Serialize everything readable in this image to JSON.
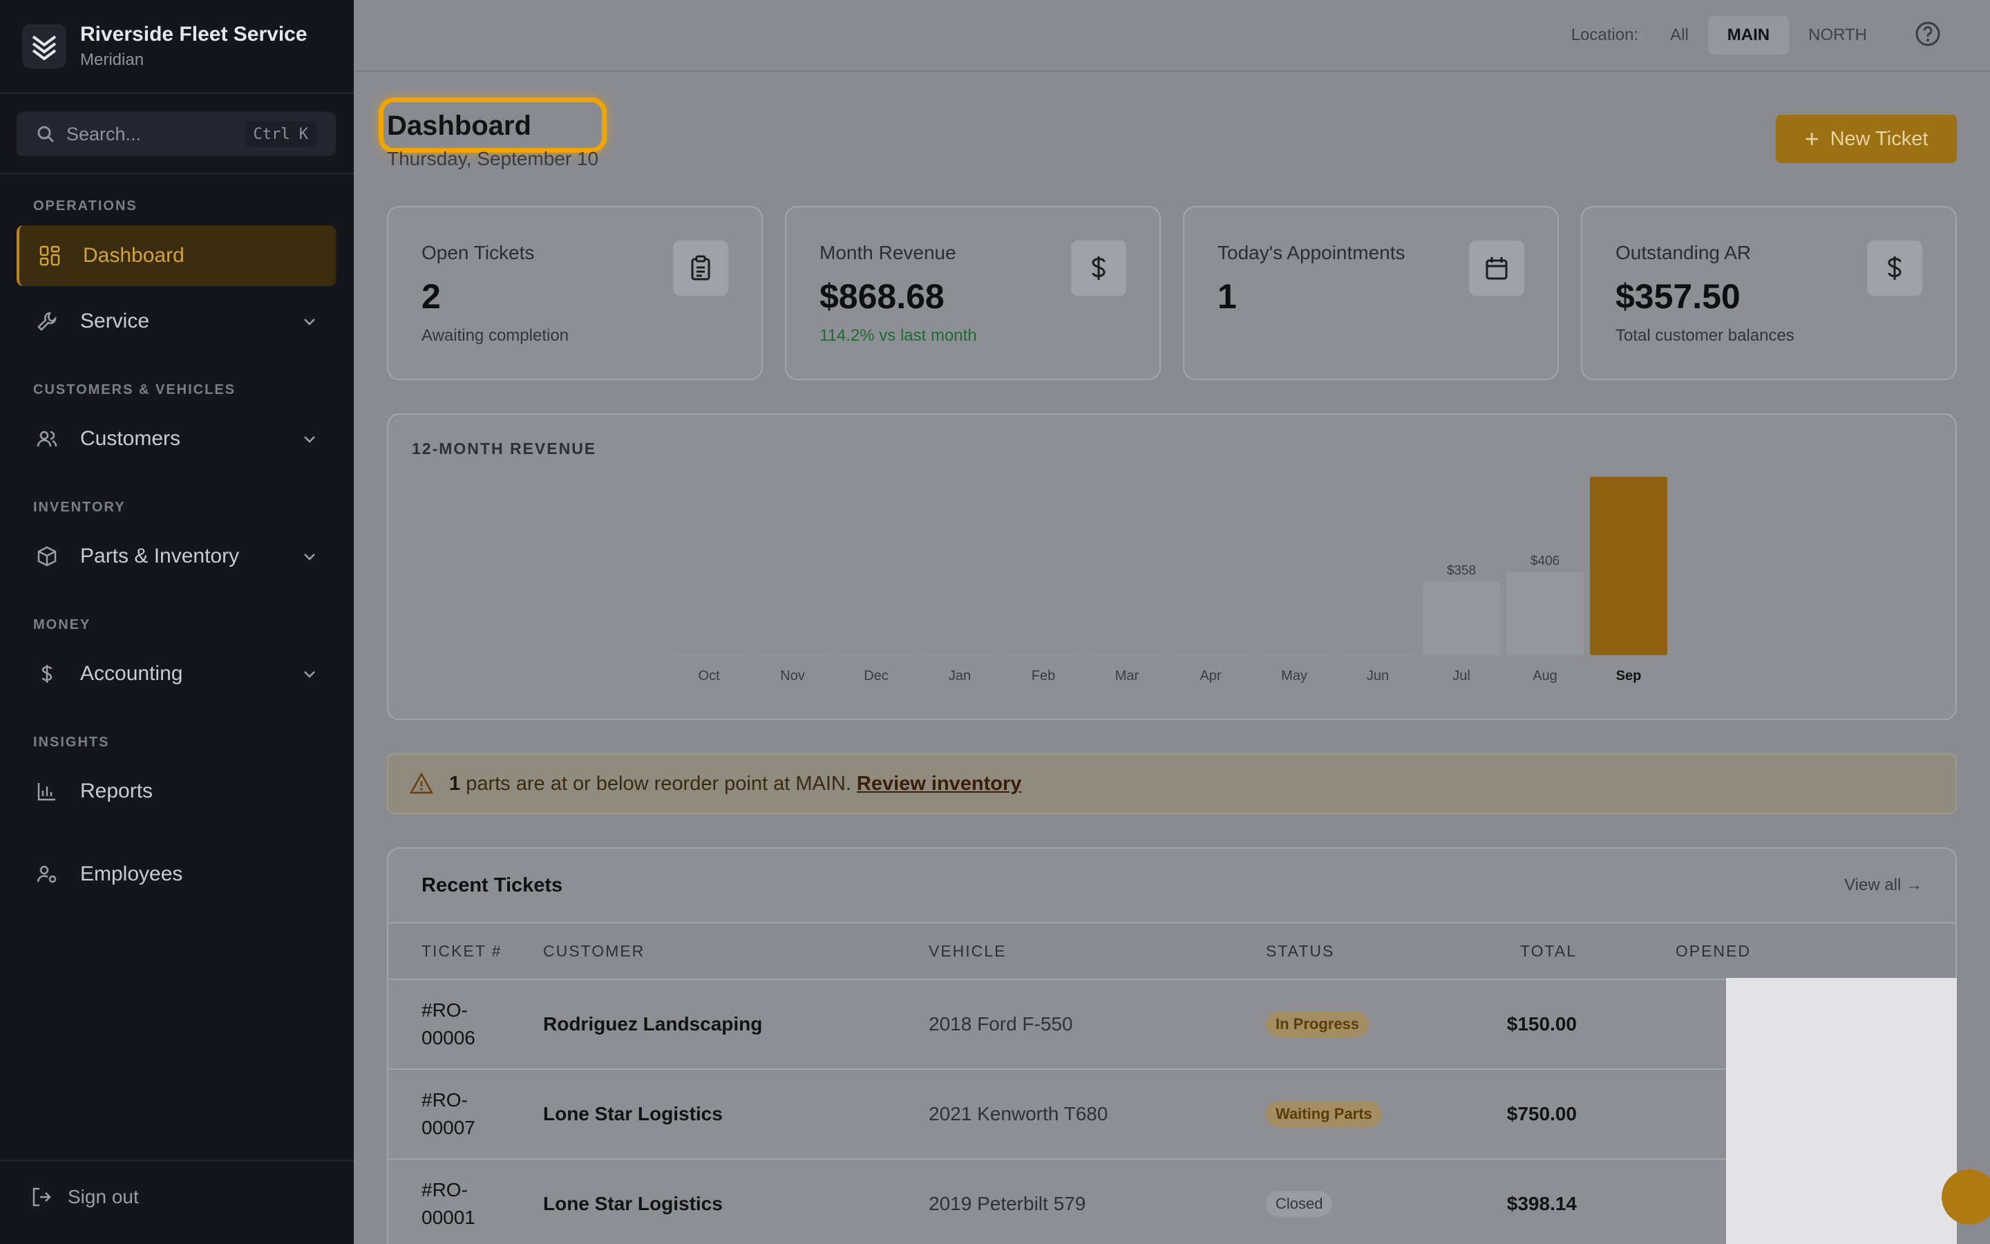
{
  "app": {
    "name": "Riverside Fleet Service",
    "subtitle": "Meridian"
  },
  "search": {
    "placeholder": "Search...",
    "shortcut": "Ctrl K"
  },
  "sidebar": {
    "sections": {
      "operations": "OPERATIONS",
      "customers_vehicles": "CUSTOMERS & VEHICLES",
      "inventory": "INVENTORY",
      "money": "MONEY",
      "insights": "INSIGHTS"
    },
    "items": {
      "dashboard": "Dashboard",
      "service": "Service",
      "customers": "Customers",
      "parts": "Parts & Inventory",
      "accounting": "Accounting",
      "reports": "Reports",
      "employees": "Employees"
    },
    "signout": "Sign out"
  },
  "topbar": {
    "location_label": "Location:",
    "locations": [
      "All",
      "MAIN",
      "NORTH"
    ],
    "selected_location": "MAIN"
  },
  "page": {
    "title": "Dashboard",
    "date": "Thursday, September 10",
    "new_ticket": "New Ticket"
  },
  "cards": [
    {
      "title": "Open Tickets",
      "value": "2",
      "sub": "Awaiting completion",
      "icon": "clipboard-icon"
    },
    {
      "title": "Month Revenue",
      "value": "$868.68",
      "sub": "114.2% vs last month",
      "icon": "dollar-icon"
    },
    {
      "title": "Today's Appointments",
      "value": "1",
      "sub": "",
      "icon": "calendar-icon"
    },
    {
      "title": "Outstanding AR",
      "value": "$357.50",
      "sub": "Total customer balances",
      "icon": "dollar-icon"
    }
  ],
  "chart_data": {
    "type": "bar",
    "title": "12-MONTH REVENUE",
    "categories": [
      "Oct",
      "Nov",
      "Dec",
      "Jan",
      "Feb",
      "Mar",
      "Apr",
      "May",
      "Jun",
      "Jul",
      "Aug",
      "Sep"
    ],
    "values": [
      0,
      0,
      0,
      0,
      0,
      0,
      0,
      0,
      0,
      358,
      406,
      868.68
    ],
    "data_labels": [
      "",
      "",
      "",
      "",
      "",
      "",
      "",
      "",
      "",
      "$358",
      "$406",
      ""
    ],
    "highlight": "Sep",
    "colors": {
      "bar": "#96979c",
      "highlight": "#8e6112"
    }
  },
  "alert": {
    "count": "1",
    "text": "parts are at or below reorder point at MAIN.",
    "link": "Review inventory"
  },
  "tickets": {
    "title": "Recent Tickets",
    "view_all": "View all →",
    "headers": {
      "num": "TICKET #",
      "customer": "CUSTOMER",
      "vehicle": "VEHICLE",
      "status": "STATUS",
      "total": "TOTAL",
      "opened": "OPENED"
    },
    "rows": [
      {
        "num_a": "#RO-",
        "num_b": "00006",
        "customer": "Rodriguez Landscaping",
        "vehicle": "2018 Ford F-550",
        "status": "In Progress",
        "total": "$150.00"
      },
      {
        "num_a": "#RO-",
        "num_b": "00007",
        "customer": "Lone Star Logistics",
        "vehicle": "2021 Kenworth T680",
        "status": "Waiting Parts",
        "total": "$750.00"
      },
      {
        "num_a": "#RO-",
        "num_b": "00001",
        "customer": "Lone Star Logistics",
        "vehicle": "2019 Peterbilt 579",
        "status": "Closed",
        "total": "$398.14"
      }
    ]
  },
  "colors": {
    "sidebar_bg": "#14161c",
    "accent": "#b8861a",
    "positive": "#1d6b32"
  }
}
